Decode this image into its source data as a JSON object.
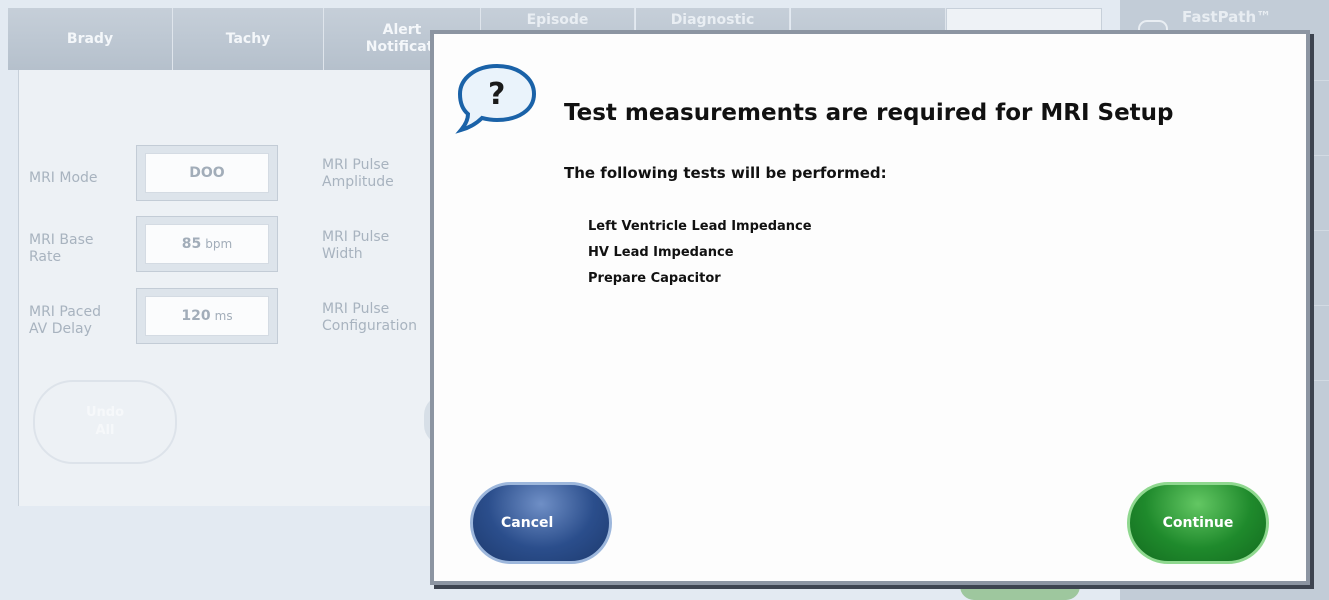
{
  "tabs": [
    {
      "label": "Brady"
    },
    {
      "label": "Tachy"
    },
    {
      "label": "Alert\nNotificati"
    },
    {
      "label": "Episode"
    },
    {
      "label": "Diagnostic"
    },
    {
      "label": ""
    },
    {
      "label": ""
    }
  ],
  "sidebar": {
    "fastpath_label": "FastPath™"
  },
  "settings": {
    "mri_mode": {
      "label": "MRI Mode",
      "value": "DOO"
    },
    "mri_base_rate": {
      "label": "MRI Base\nRate",
      "value": "85",
      "unit": "bpm"
    },
    "mri_paced_av_delay": {
      "label": "MRI Paced\nAV Delay",
      "value": "120",
      "unit": "ms"
    },
    "mri_pulse_amplitude": {
      "label": "MRI Pulse\nAmplitude"
    },
    "mri_pulse_width": {
      "label": "MRI Pulse\nWidth"
    },
    "mri_pulse_configuration": {
      "label": "MRI Pulse\nConfiguration"
    }
  },
  "undo_all_label": "Undo\nAll",
  "dialog": {
    "title": "Test measurements are required for MRI Setup",
    "subtitle": "The following tests will be performed:",
    "tests": [
      "Left Ventricle Lead Impedance",
      "HV Lead Impedance",
      "Prepare Capacitor"
    ],
    "cancel_label": "Cancel",
    "continue_label": "Continue",
    "icon": "help-bubble-icon"
  }
}
